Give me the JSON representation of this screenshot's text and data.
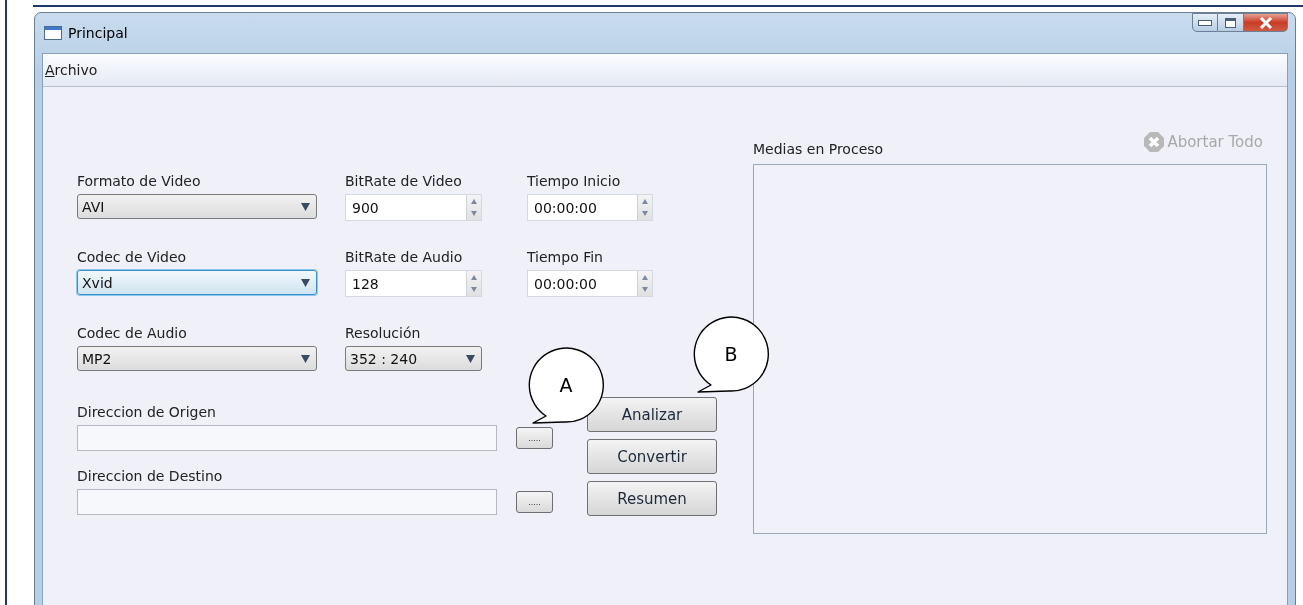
{
  "window": {
    "title": "Principal"
  },
  "menu": [
    {
      "label": "Archivo"
    }
  ],
  "settings": [
    [
      {
        "kind": "dropdown",
        "label": "Formato de Video",
        "value": "AVI",
        "focused": false
      },
      {
        "kind": "dropdown",
        "label": "Codec de Video",
        "value": "Xvid",
        "focused": true
      },
      {
        "kind": "dropdown",
        "label": "Codec de Audio",
        "value": "MP2",
        "focused": false
      }
    ],
    [
      {
        "kind": "spin",
        "label": "BitRate de Video",
        "value": "900",
        "focused": false
      },
      {
        "kind": "spin",
        "label": "BitRate de Audio",
        "value": "128",
        "focused": false
      },
      {
        "kind": "dropdown",
        "label": "Resolución",
        "value": "352 : 240",
        "focused": false
      }
    ],
    [
      {
        "kind": "spin",
        "label": "Tiempo Inicio",
        "value": "00:00:00",
        "focused": false
      },
      {
        "kind": "spin",
        "label": "Tiempo Fin",
        "value": "00:00:00",
        "focused": false
      }
    ]
  ],
  "paths": [
    {
      "label": "Direccion de Origen",
      "browse": "....."
    },
    {
      "label": "Direccion de Destino",
      "browse": "....."
    }
  ],
  "actions": [
    "Analizar",
    "Convertir",
    "Resumen"
  ],
  "panel": {
    "title": "Medias en Proceso",
    "abort": {
      "label": "Abortar Todo",
      "disabled": true
    }
  },
  "callouts": [
    {
      "label": "A"
    },
    {
      "label": "B"
    }
  ]
}
